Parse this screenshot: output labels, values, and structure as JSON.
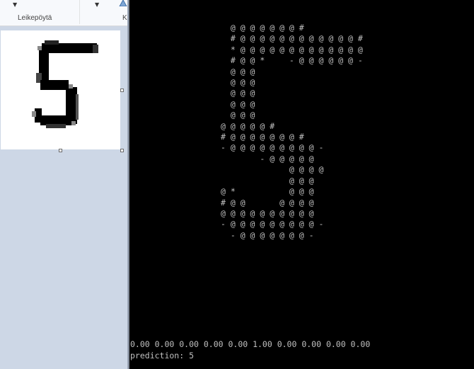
{
  "paint": {
    "ribbon": {
      "groups": [
        "Leikepöytä",
        "Ku"
      ]
    },
    "canvas_digit": "5"
  },
  "console": {
    "ascii_art": [
      "@ @ @ @ @ @ @ #",
      "# @ @ @ @ @ @ @ @ @ @ @ @ #",
      "* @ @ @ @ @ @ @ @ @ @ @ @ @",
      "# @ @ *     - @ @ @ @ @ @ -",
      "@ @ @",
      "@ @ @",
      "@ @ @",
      "@ @ @",
      "@ @ @",
      "@ @ @ @ @ #",
      "# @ @ @ @ @ @ @ #",
      "- @ @ @ @ @ @ @ @ @ -",
      "- @ @ @ @ @",
      "@ @ @ @",
      "@ @ @",
      "@ *           @ @ @",
      "# @ @       @ @ @ @",
      "@ @ @ @ @ @ @ @ @ @",
      "- @ @ @ @ @ @ @ @ @ -",
      "- @ @ @ @ @ @ @ -"
    ],
    "probabilities": "0.00 0.00 0.00 0.00 0.00 1.00 0.00 0.00 0.00 0.00",
    "prediction": "prediction: 5"
  },
  "colors": {
    "console_bg": "#000000",
    "console_text": "#c0c0c0",
    "paint_bg": "#cdd7e6",
    "canvas": "#ffffff",
    "ink": "#000000"
  }
}
